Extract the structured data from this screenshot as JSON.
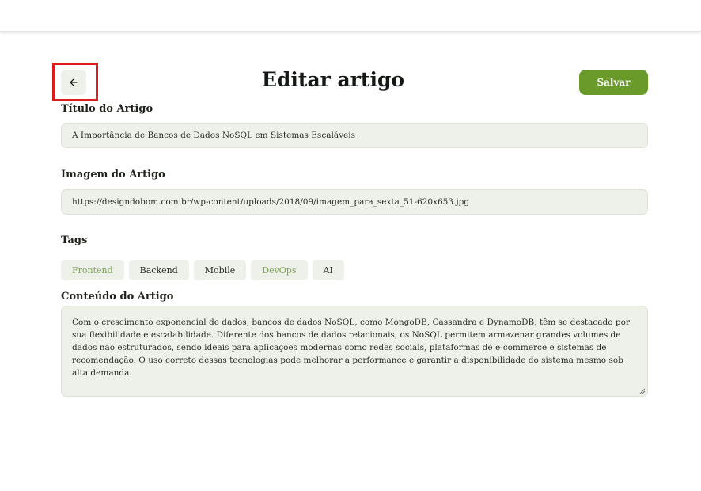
{
  "header": {
    "title": "Editar artigo",
    "save_label": "Salvar",
    "back_icon": "arrow-left-icon"
  },
  "fields": {
    "title_label": "Título do Artigo",
    "title_value": "A Importância de Bancos de Dados NoSQL em Sistemas Escaláveis",
    "image_label": "Imagem do Artigo",
    "image_value": "https://designdobom.com.br/wp-content/uploads/2018/09/imagem_para_sexta_51-620x653.jpg",
    "tags_label": "Tags",
    "content_label": "Conteúdo do Artigo",
    "content_value": "Com o crescimento exponencial de dados, bancos de dados NoSQL, como MongoDB, Cassandra e DynamoDB, têm se destacado por sua flexibilidade e escalabilidade. Diferente dos bancos de dados relacionais, os NoSQL permitem armazenar grandes volumes de dados não estruturados, sendo ideais para aplicações modernas como redes sociais, plataformas de e-commerce e sistemas de recomendação. O uso correto dessas tecnologias pode melhorar a performance e garantir a disponibilidade do sistema mesmo sob alta demanda."
  },
  "tags": [
    {
      "label": "Frontend",
      "selected": true
    },
    {
      "label": "Backend",
      "selected": false
    },
    {
      "label": "Mobile",
      "selected": false
    },
    {
      "label": "DevOps",
      "selected": true
    },
    {
      "label": "AI",
      "selected": false
    }
  ],
  "colors": {
    "accent": "#6a9a2a",
    "field_bg": "#eef1e9",
    "selected_tag_text": "#7fa35a",
    "highlight": "#e01b1b"
  }
}
